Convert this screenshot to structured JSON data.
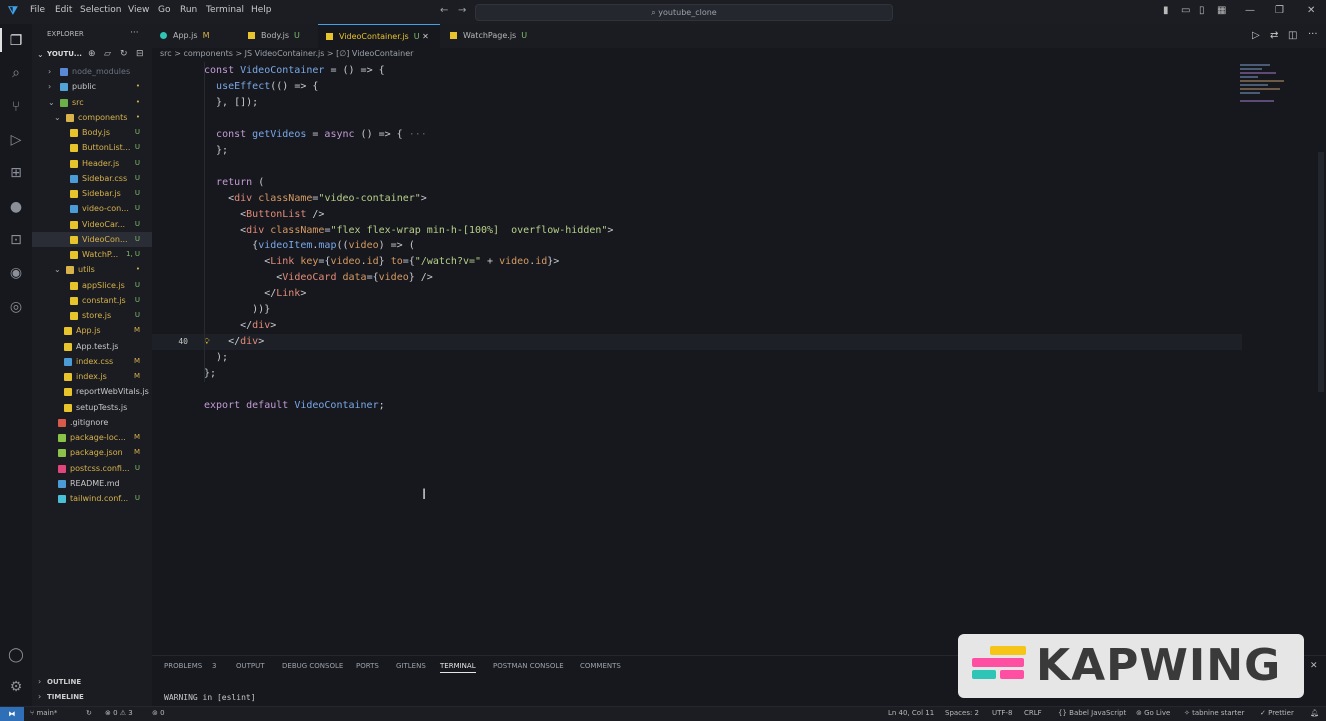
{
  "menu": [
    "File",
    "Edit",
    "Selection",
    "View",
    "Go",
    "Run",
    "Terminal",
    "Help"
  ],
  "search": {
    "text": "youtube_clone"
  },
  "window_controls": [
    "—",
    "❐",
    "✕"
  ],
  "explorer": {
    "title": "EXPLORER",
    "root": "YOUTU...",
    "items": [
      {
        "label": "node_modules",
        "status": "",
        "color": "#6c7280",
        "icon": "#5a8ad6",
        "indent": 1,
        "folder": true
      },
      {
        "label": "public",
        "status": "•",
        "color": "#c8c8c8",
        "icon": "#52a3d8",
        "indent": 1,
        "folder": true
      },
      {
        "label": "src",
        "status": "•",
        "color": "#d8b24a",
        "icon": "#6cae4a",
        "indent": 1,
        "folder": true,
        "open": true
      },
      {
        "label": "components",
        "status": "•",
        "color": "#d8b24a",
        "icon": "#d8b24a",
        "indent": 2,
        "folder": true,
        "open": true
      },
      {
        "label": "Body.js",
        "status": "U",
        "color": "#d8b24a",
        "icon": "#e7c32c",
        "indent": 3
      },
      {
        "label": "ButtonList...",
        "status": "U",
        "color": "#d8b24a",
        "icon": "#e7c32c",
        "indent": 3
      },
      {
        "label": "Header.js",
        "status": "U",
        "color": "#d8b24a",
        "icon": "#e7c32c",
        "indent": 3
      },
      {
        "label": "Sidebar.css",
        "status": "U",
        "color": "#d8b24a",
        "icon": "#4a9bd6",
        "indent": 3
      },
      {
        "label": "Sidebar.js",
        "status": "U",
        "color": "#d8b24a",
        "icon": "#e7c32c",
        "indent": 3
      },
      {
        "label": "video-con...",
        "status": "U",
        "color": "#d8b24a",
        "icon": "#4a9bd6",
        "indent": 3
      },
      {
        "label": "VideoCar...",
        "status": "U",
        "color": "#d8b24a",
        "icon": "#e7c32c",
        "indent": 3
      },
      {
        "label": "VideoCon...",
        "status": "U",
        "color": "#d8b24a",
        "icon": "#e7c32c",
        "indent": 3,
        "selected": true
      },
      {
        "label": "WatchP...",
        "status": "1, U",
        "color": "#d8b24a",
        "icon": "#e7c32c",
        "indent": 3
      },
      {
        "label": "utils",
        "status": "•",
        "color": "#d8b24a",
        "icon": "#d8b24a",
        "indent": 2,
        "folder": true,
        "open": true
      },
      {
        "label": "appSlice.js",
        "status": "U",
        "color": "#d8b24a",
        "icon": "#e7c32c",
        "indent": 3
      },
      {
        "label": "constant.js",
        "status": "U",
        "color": "#d8b24a",
        "icon": "#e7c32c",
        "indent": 3
      },
      {
        "label": "store.js",
        "status": "U",
        "color": "#d8b24a",
        "icon": "#e7c32c",
        "indent": 3
      },
      {
        "label": "App.js",
        "status": "M",
        "color": "#d8b24a",
        "icon": "#e7c32c",
        "indent": 2
      },
      {
        "label": "App.test.js",
        "status": "",
        "color": "#c8c8c8",
        "icon": "#e7c32c",
        "indent": 2
      },
      {
        "label": "index.css",
        "status": "M",
        "color": "#d8b24a",
        "icon": "#4a9bd6",
        "indent": 2
      },
      {
        "label": "index.js",
        "status": "M",
        "color": "#d8b24a",
        "icon": "#e7c32c",
        "indent": 2
      },
      {
        "label": "reportWebVitals.js",
        "status": "",
        "color": "#c8c8c8",
        "icon": "#e7c32c",
        "indent": 2
      },
      {
        "label": "setupTests.js",
        "status": "",
        "color": "#c8c8c8",
        "icon": "#e7c32c",
        "indent": 2
      },
      {
        "label": ".gitignore",
        "status": "",
        "color": "#c8c8c8",
        "icon": "#d85a4a",
        "indent": 1
      },
      {
        "label": "package-loc...",
        "status": "M",
        "color": "#d8b24a",
        "icon": "#8bc34a",
        "indent": 1
      },
      {
        "label": "package.json",
        "status": "M",
        "color": "#d8b24a",
        "icon": "#8bc34a",
        "indent": 1
      },
      {
        "label": "postcss.confi...",
        "status": "U",
        "color": "#d8b24a",
        "icon": "#e0457b",
        "indent": 1
      },
      {
        "label": "README.md",
        "status": "",
        "color": "#c8c8c8",
        "icon": "#4a9bd6",
        "indent": 1
      },
      {
        "label": "tailwind.conf...",
        "status": "U",
        "color": "#d8b24a",
        "icon": "#4ac0d6",
        "indent": 1
      }
    ],
    "outline": "OUTLINE",
    "timeline": "TIMELINE"
  },
  "tabs": [
    {
      "label": "App.js",
      "status": "M"
    },
    {
      "label": "Body.js",
      "status": "U"
    },
    {
      "label": "VideoContainer.js",
      "status": "U",
      "active": true
    },
    {
      "label": "WatchPage.js",
      "status": "U"
    }
  ],
  "breadcrumb": "src > components > JS VideoContainer.js > [∅] VideoContainer",
  "code_lines": [
    {
      "n": "",
      "t": [
        [
          "kw",
          "const "
        ],
        [
          "fn",
          "VideoContainer"
        ],
        [
          "pl",
          " = () => {"
        ]
      ]
    },
    {
      "n": "",
      "t": [
        [
          "pl",
          "  "
        ],
        [
          "fn",
          "useEffect"
        ],
        [
          "pl",
          "(() => {"
        ]
      ]
    },
    {
      "n": "",
      "t": [
        [
          "pl",
          "  }, []);"
        ]
      ]
    },
    {
      "n": "",
      "t": [
        [
          "pl",
          ""
        ]
      ]
    },
    {
      "n": "",
      "t": [
        [
          "pl",
          "  "
        ],
        [
          "kw",
          "const "
        ],
        [
          "fn",
          "getVideos"
        ],
        [
          "pl",
          " = "
        ],
        [
          "kw",
          "async"
        ],
        [
          "pl",
          " () => { "
        ],
        [
          "dim",
          "···"
        ]
      ]
    },
    {
      "n": "",
      "t": [
        [
          "pl",
          "  };"
        ]
      ]
    },
    {
      "n": "",
      "t": [
        [
          "pl",
          ""
        ]
      ]
    },
    {
      "n": "",
      "t": [
        [
          "pl",
          "  "
        ],
        [
          "kw",
          "return"
        ],
        [
          "pl",
          " ("
        ]
      ]
    },
    {
      "n": "",
      "t": [
        [
          "pl",
          "    <"
        ],
        [
          "tg",
          "div"
        ],
        [
          "pl",
          " "
        ],
        [
          "at",
          "className"
        ],
        [
          "pl",
          "="
        ],
        [
          "str",
          "\"video-container\""
        ],
        [
          "pl",
          ">"
        ]
      ]
    },
    {
      "n": "",
      "t": [
        [
          "pl",
          "      <"
        ],
        [
          "tg",
          "ButtonList"
        ],
        [
          "pl",
          " />"
        ]
      ]
    },
    {
      "n": "",
      "t": [
        [
          "pl",
          "      <"
        ],
        [
          "tg",
          "div"
        ],
        [
          "pl",
          " "
        ],
        [
          "at",
          "className"
        ],
        [
          "pl",
          "="
        ],
        [
          "str",
          "\"flex flex-wrap min-h-[100%]  overflow-hidden\""
        ],
        [
          "pl",
          ">"
        ]
      ]
    },
    {
      "n": "",
      "t": [
        [
          "pl",
          "        {"
        ],
        [
          "fn",
          "videoItem"
        ],
        [
          "pl",
          "."
        ],
        [
          "fn",
          "map"
        ],
        [
          "pl",
          "(("
        ],
        [
          "at",
          "video"
        ],
        [
          "pl",
          ") => ("
        ]
      ]
    },
    {
      "n": "",
      "t": [
        [
          "pl",
          "          <"
        ],
        [
          "tg",
          "Link"
        ],
        [
          "pl",
          " "
        ],
        [
          "at",
          "key"
        ],
        [
          "pl",
          "={"
        ],
        [
          "at",
          "video"
        ],
        [
          "pl",
          "."
        ],
        [
          "at",
          "id"
        ],
        [
          "pl",
          "} "
        ],
        [
          "at",
          "to"
        ],
        [
          "pl",
          "={"
        ],
        [
          "str",
          "\"/watch?v=\""
        ],
        [
          "pl",
          " + "
        ],
        [
          "at",
          "video"
        ],
        [
          "pl",
          "."
        ],
        [
          "at",
          "id"
        ],
        [
          "pl",
          "}>"
        ]
      ]
    },
    {
      "n": "",
      "t": [
        [
          "pl",
          "            <"
        ],
        [
          "tg",
          "VideoCard"
        ],
        [
          "pl",
          " "
        ],
        [
          "at",
          "data"
        ],
        [
          "pl",
          "={"
        ],
        [
          "at",
          "video"
        ],
        [
          "pl",
          "} />"
        ]
      ]
    },
    {
      "n": "",
      "t": [
        [
          "pl",
          "          </"
        ],
        [
          "tg",
          "Link"
        ],
        [
          "pl",
          ">"
        ]
      ]
    },
    {
      "n": "",
      "t": [
        [
          "pl",
          "        ))}"
        ]
      ]
    },
    {
      "n": "",
      "t": [
        [
          "pl",
          "      </"
        ],
        [
          "tg",
          "div"
        ],
        [
          "pl",
          ">"
        ]
      ]
    },
    {
      "n": "40",
      "t": [
        [
          "pl",
          "    </"
        ],
        [
          "tg",
          "div"
        ],
        [
          "pl",
          ">"
        ]
      ]
    },
    {
      "n": "",
      "t": [
        [
          "pl",
          "  );"
        ]
      ]
    },
    {
      "n": "",
      "t": [
        [
          "pl",
          "};"
        ]
      ]
    },
    {
      "n": "",
      "t": [
        [
          "pl",
          ""
        ]
      ]
    },
    {
      "n": "",
      "t": [
        [
          "kw",
          "export default "
        ],
        [
          "fn",
          "VideoContainer"
        ],
        [
          "pl",
          ";"
        ]
      ]
    },
    {
      "n": "",
      "t": [
        [
          "pl",
          ""
        ]
      ]
    }
  ],
  "panel_tabs": [
    "PROBLEMS",
    "3",
    "OUTPUT",
    "DEBUG CONSOLE",
    "PORTS",
    "GITLENS",
    "TERMINAL",
    "POSTMAN CONSOLE",
    "COMMENTS"
  ],
  "terminal_line": "WARNING in [eslint]",
  "status": {
    "branch": "main*",
    "errors": "⊗ 0 ⚠ 3",
    "ports": "0",
    "cursor": "Ln 40, Col 11",
    "spaces": "Spaces: 2",
    "encoding": "UTF-8",
    "eol": "CRLF",
    "language": "Babel JavaScript",
    "golive": "Go Live",
    "tabnine": "tabnine starter",
    "prettier": "Prettier"
  },
  "watermark": "KAPWING"
}
